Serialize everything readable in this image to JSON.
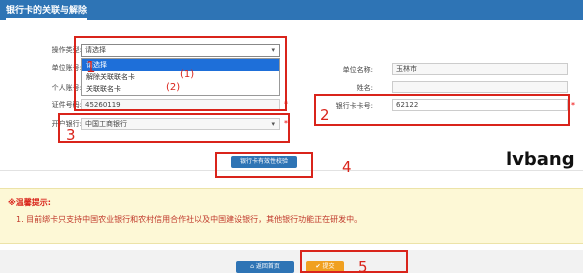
{
  "header": {
    "title": "银行卡的关联与解除"
  },
  "form": {
    "operation_type": {
      "label": "操作类型:",
      "value": "请选择"
    },
    "unit_no": {
      "label": "单位账号:"
    },
    "personal_no": {
      "label": "个人账号:"
    },
    "id_no": {
      "label": "证件号码:",
      "value": "45260119"
    },
    "bank": {
      "label": "开户银行:",
      "value": "中国工商银行"
    },
    "unit_name": {
      "label": "单位名称:",
      "value": "玉林市"
    },
    "name": {
      "label": "姓名:"
    },
    "card_no": {
      "label": "银行卡卡号:",
      "value": "62122"
    },
    "required_mark": "*"
  },
  "dropdown": {
    "options": [
      "请选择",
      "解除关联联名卡",
      "关联联名卡"
    ]
  },
  "annotations": {
    "n1": "1",
    "n2": "2",
    "n3": "3",
    "n4": "4",
    "n5": "5",
    "s1": "(1)",
    "s2": "(2)"
  },
  "verify_button": "银行卡有效性校验",
  "notice": {
    "title": "※温馨提示:",
    "items": [
      "1. 目前绑卡只支持中国农业银行和农村信用合作社以及中国建设银行，其他银行功能正在研发中。"
    ]
  },
  "buttons": {
    "back": "返回首页",
    "submit": "提交"
  },
  "watermark": "lvbang"
}
